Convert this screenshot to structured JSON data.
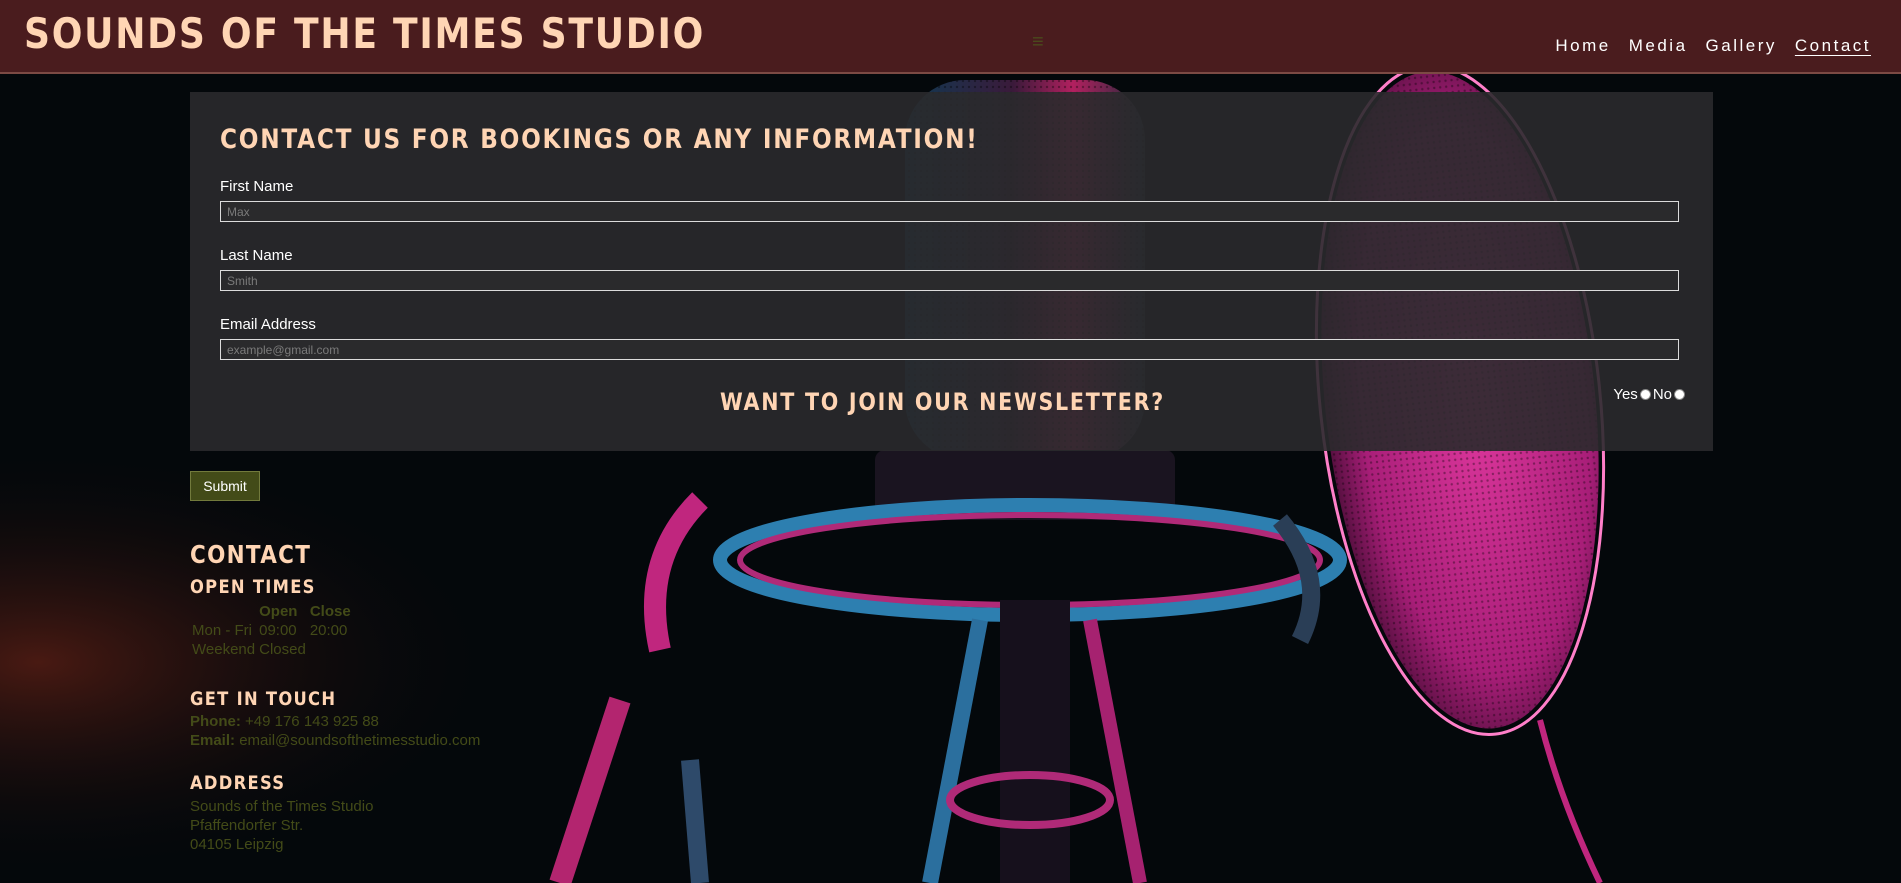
{
  "header": {
    "site_title": "SOUNDS OF THE TIMES STUDIO",
    "menu_icon": "hamburger-icon",
    "nav": [
      {
        "label": "Home",
        "active": false
      },
      {
        "label": "Media",
        "active": false
      },
      {
        "label": "Gallery",
        "active": false
      },
      {
        "label": "Contact",
        "active": true
      }
    ]
  },
  "form": {
    "title": "CONTACT US FOR BOOKINGS OR ANY INFORMATION!",
    "first_name": {
      "label": "First Name",
      "placeholder": "Max",
      "value": ""
    },
    "last_name": {
      "label": "Last Name",
      "placeholder": "Smith",
      "value": ""
    },
    "email": {
      "label": "Email Address",
      "placeholder": "example@gmail.com",
      "value": ""
    },
    "newsletter": {
      "title": "WANT TO JOIN OUR NEWSLETTER?",
      "yes_label": "Yes",
      "no_label": "No"
    },
    "submit_label": "Submit"
  },
  "contact": {
    "title": "CONTACT",
    "open_times": {
      "title": "OPEN TIMES",
      "headers": [
        "",
        "Open",
        "Close"
      ],
      "rows": [
        [
          "Mon - Fri",
          "09:00",
          "20:00"
        ],
        [
          "Weekend",
          "Closed",
          ""
        ]
      ]
    },
    "get_in_touch": {
      "title": "GET IN TOUCH",
      "phone_label": "Phone:",
      "phone": "+49 176 143 925 88",
      "email_label": "Email:",
      "email": "email@soundsofthetimesstudio.com"
    },
    "address": {
      "title": "ADDRESS",
      "lines": [
        "Sounds of the Times Studio",
        "Pfaffendorfer Str.",
        "04105 Leipzig"
      ]
    }
  },
  "colors": {
    "header_bg": "#4a1c1e",
    "heading": "#ffd5b4",
    "olive_text": "#434b18",
    "submit_bg": "#434b18",
    "panel_bg": "#2a2a2c"
  }
}
